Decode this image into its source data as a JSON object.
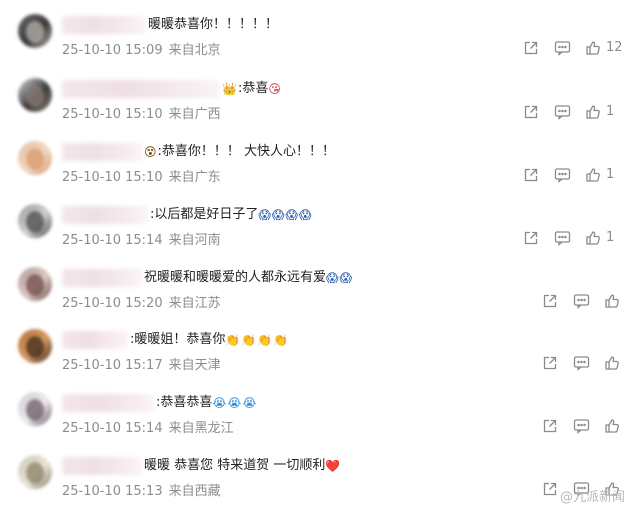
{
  "comments": [
    {
      "text_parts": [
        {
          "t": "暖暖恭喜你！！！！！"
        }
      ],
      "time": "25-10-10 15:09",
      "location": "来自北京",
      "likes": "12",
      "name_width": 84,
      "avatar": [
        "#6a6a6a",
        "#b7b0a8",
        "#3a3a3a"
      ]
    },
    {
      "text_parts": [
        {
          "e": "👑"
        },
        {
          "t": ":恭喜"
        },
        {
          "e": "😘"
        }
      ],
      "time": "25-10-10 15:10",
      "location": "来自广西",
      "likes": "1",
      "name_width": 158,
      "avatar": [
        "#d6d8dc",
        "#8a7b70",
        "#3d3d3d"
      ]
    },
    {
      "text_parts": [
        {
          "e": "😵"
        },
        {
          "t": ":恭喜你！！！ 大快人心！！！"
        }
      ],
      "time": "25-10-10 15:10",
      "location": "来自广东",
      "likes": "1",
      "name_width": 80,
      "avatar": [
        "#e8c2a2",
        "#d89a6a",
        "#f1d7c3"
      ]
    },
    {
      "text_parts": [
        {
          "t": ":以后都是好日子了"
        },
        {
          "e": "😱"
        },
        {
          "e": "😱"
        },
        {
          "e": "😱"
        },
        {
          "e": "😱"
        }
      ],
      "time": "25-10-10 15:14",
      "location": "来自河南",
      "likes": "1",
      "name_width": 86,
      "avatar": [
        "#9c9c9c",
        "#4a4a4a",
        "#cfcfcf"
      ]
    },
    {
      "text_parts": [
        {
          "t": "祝暖暖和暖暖爱的人都永远有爱"
        },
        {
          "e": "😱"
        },
        {
          "e": "😱"
        }
      ],
      "time": "25-10-10 15:20",
      "location": "来自江苏",
      "likes": "",
      "name_width": 80,
      "avatar": [
        "#b39a96",
        "#6f4a45",
        "#d9c9c6"
      ]
    },
    {
      "text_parts": [
        {
          "t": ":暖暖姐！恭喜你"
        },
        {
          "e": "👏"
        },
        {
          "e": "👏"
        },
        {
          "e": "👏"
        },
        {
          "e": "👏"
        }
      ],
      "time": "25-10-10 15:17",
      "location": "来自天津",
      "likes": "",
      "name_width": 66,
      "avatar": [
        "#b5723a",
        "#3f2a1c",
        "#d59a5f"
      ]
    },
    {
      "text_parts": [
        {
          "t": ":恭喜恭喜"
        },
        {
          "e": "😭"
        },
        {
          "e": "😭"
        },
        {
          "e": "😭"
        }
      ],
      "time": "25-10-10 15:14",
      "location": "来自黑龙江",
      "likes": "",
      "name_width": 92,
      "avatar": [
        "#cfcbd1",
        "#6b5a66",
        "#eeeaec"
      ]
    },
    {
      "text_parts": [
        {
          "t": "暖暖 恭喜您 特来道贺 一切顺利"
        },
        {
          "e": "❤️"
        }
      ],
      "time": "25-10-10 15:13",
      "location": "来自西藏",
      "likes": "",
      "name_width": 80,
      "avatar": [
        "#cdc9b8",
        "#8b8066",
        "#e8e4d6"
      ]
    }
  ],
  "icons": {
    "share": "share-icon",
    "comment": "comment-icon",
    "like": "thumb-up-icon"
  },
  "watermark": "@九派新闻",
  "colors": {
    "meta": "#8d8d8d",
    "text": "#222222",
    "heart": "#e0303a"
  }
}
